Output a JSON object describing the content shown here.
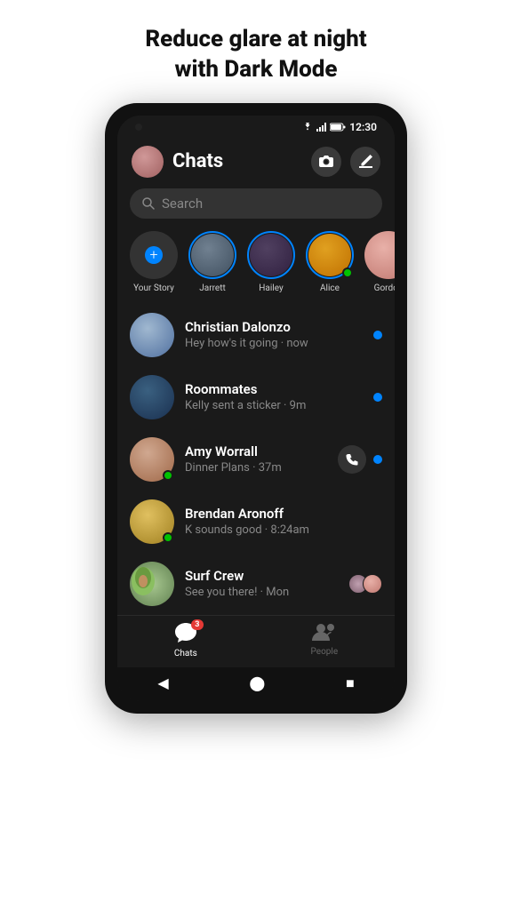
{
  "headline": {
    "line1": "Reduce glare at night",
    "line2": "with Dark Mode"
  },
  "status_bar": {
    "time": "12:30"
  },
  "header": {
    "title": "Chats",
    "camera_label": "Camera",
    "compose_label": "Compose"
  },
  "search": {
    "placeholder": "Search"
  },
  "stories": [
    {
      "id": "your-story",
      "name": "Your Story",
      "type": "add"
    },
    {
      "id": "jarrett",
      "name": "Jarrett",
      "type": "ring",
      "has_dot": false
    },
    {
      "id": "hailey",
      "name": "Hailey",
      "type": "ring",
      "has_dot": false
    },
    {
      "id": "alice",
      "name": "Alice",
      "type": "ring",
      "has_dot": true
    },
    {
      "id": "gordon",
      "name": "Gordon",
      "type": "plain",
      "has_dot": false
    }
  ],
  "chats": [
    {
      "id": "christian",
      "name": "Christian Dalonzo",
      "preview": "Hey how's it going · now",
      "unread": true,
      "has_call": false,
      "has_green_dot": false,
      "has_group_avatars": false
    },
    {
      "id": "roommates",
      "name": "Roommates",
      "preview": "Kelly sent a sticker · 9m",
      "unread": true,
      "has_call": false,
      "has_green_dot": false,
      "has_group_avatars": false
    },
    {
      "id": "amy",
      "name": "Amy Worrall",
      "preview": "Dinner Plans · 37m",
      "unread": true,
      "has_call": true,
      "has_green_dot": true,
      "has_group_avatars": false
    },
    {
      "id": "brendan",
      "name": "Brendan Aronoff",
      "preview": "K sounds good · 8:24am",
      "unread": false,
      "has_call": false,
      "has_green_dot": true,
      "has_group_avatars": false
    },
    {
      "id": "surfcrew",
      "name": "Surf Crew",
      "preview": "See you there! · Mon",
      "unread": false,
      "has_call": false,
      "has_green_dot": false,
      "has_group_avatars": true
    }
  ],
  "bottom_nav": {
    "chats_label": "Chats",
    "chats_badge": "3",
    "people_label": "People"
  },
  "android_nav": {
    "back": "◀",
    "home": "⬤",
    "recents": "■"
  }
}
